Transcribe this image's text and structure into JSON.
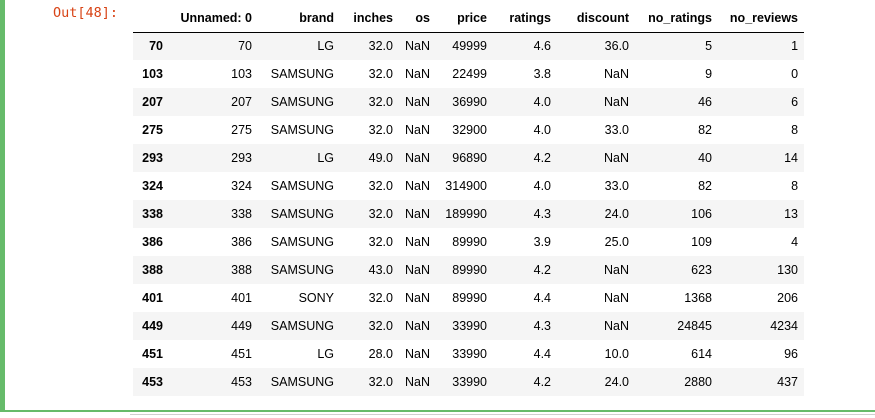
{
  "prompt": "Out[48]:",
  "columns": [
    "Unnamed: 0",
    "brand",
    "inches",
    "os",
    "price",
    "ratings",
    "discount",
    "no_ratings",
    "no_reviews"
  ],
  "rows": [
    {
      "index": "70",
      "cells": [
        "70",
        "LG",
        "32.0",
        "NaN",
        "49999",
        "4.6",
        "36.0",
        "5",
        "1"
      ]
    },
    {
      "index": "103",
      "cells": [
        "103",
        "SAMSUNG",
        "32.0",
        "NaN",
        "22499",
        "3.8",
        "NaN",
        "9",
        "0"
      ]
    },
    {
      "index": "207",
      "cells": [
        "207",
        "SAMSUNG",
        "32.0",
        "NaN",
        "36990",
        "4.0",
        "NaN",
        "46",
        "6"
      ]
    },
    {
      "index": "275",
      "cells": [
        "275",
        "SAMSUNG",
        "32.0",
        "NaN",
        "32900",
        "4.0",
        "33.0",
        "82",
        "8"
      ]
    },
    {
      "index": "293",
      "cells": [
        "293",
        "LG",
        "49.0",
        "NaN",
        "96890",
        "4.2",
        "NaN",
        "40",
        "14"
      ]
    },
    {
      "index": "324",
      "cells": [
        "324",
        "SAMSUNG",
        "32.0",
        "NaN",
        "314900",
        "4.0",
        "33.0",
        "82",
        "8"
      ]
    },
    {
      "index": "338",
      "cells": [
        "338",
        "SAMSUNG",
        "32.0",
        "NaN",
        "189990",
        "4.3",
        "24.0",
        "106",
        "13"
      ]
    },
    {
      "index": "386",
      "cells": [
        "386",
        "SAMSUNG",
        "32.0",
        "NaN",
        "89990",
        "3.9",
        "25.0",
        "109",
        "4"
      ]
    },
    {
      "index": "388",
      "cells": [
        "388",
        "SAMSUNG",
        "43.0",
        "NaN",
        "89990",
        "4.2",
        "NaN",
        "623",
        "130"
      ]
    },
    {
      "index": "401",
      "cells": [
        "401",
        "SONY",
        "32.0",
        "NaN",
        "89990",
        "4.4",
        "NaN",
        "1368",
        "206"
      ]
    },
    {
      "index": "449",
      "cells": [
        "449",
        "SAMSUNG",
        "32.0",
        "NaN",
        "33990",
        "4.3",
        "NaN",
        "24845",
        "4234"
      ]
    },
    {
      "index": "451",
      "cells": [
        "451",
        "LG",
        "28.0",
        "NaN",
        "33990",
        "4.4",
        "10.0",
        "614",
        "96"
      ]
    },
    {
      "index": "453",
      "cells": [
        "453",
        "SAMSUNG",
        "32.0",
        "NaN",
        "33990",
        "4.2",
        "24.0",
        "2880",
        "437"
      ]
    }
  ],
  "colors": {
    "cell_border": "#66bb6a",
    "prompt_text": "#d84315",
    "row_stripe": "#f5f5f5"
  }
}
